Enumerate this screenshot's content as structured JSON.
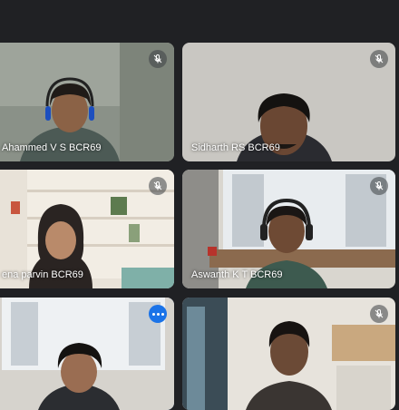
{
  "participants": [
    {
      "name": "Ahammed V S BCR69",
      "muted": true
    },
    {
      "name": "Sidharth RS BCR69",
      "muted": true
    },
    {
      "name": "ena parvin BCR69",
      "muted": true
    },
    {
      "name": "Aswanth K T BCR69",
      "muted": true
    },
    {
      "name": "",
      "muted": false,
      "active_speaker": true
    },
    {
      "name": "",
      "muted": true
    }
  ],
  "icons": {
    "mute": "mic-off-icon",
    "more": "more-options-icon"
  },
  "colors": {
    "background": "#202124",
    "active_border": "#8ab4f8",
    "more_button": "#1a73e8"
  }
}
